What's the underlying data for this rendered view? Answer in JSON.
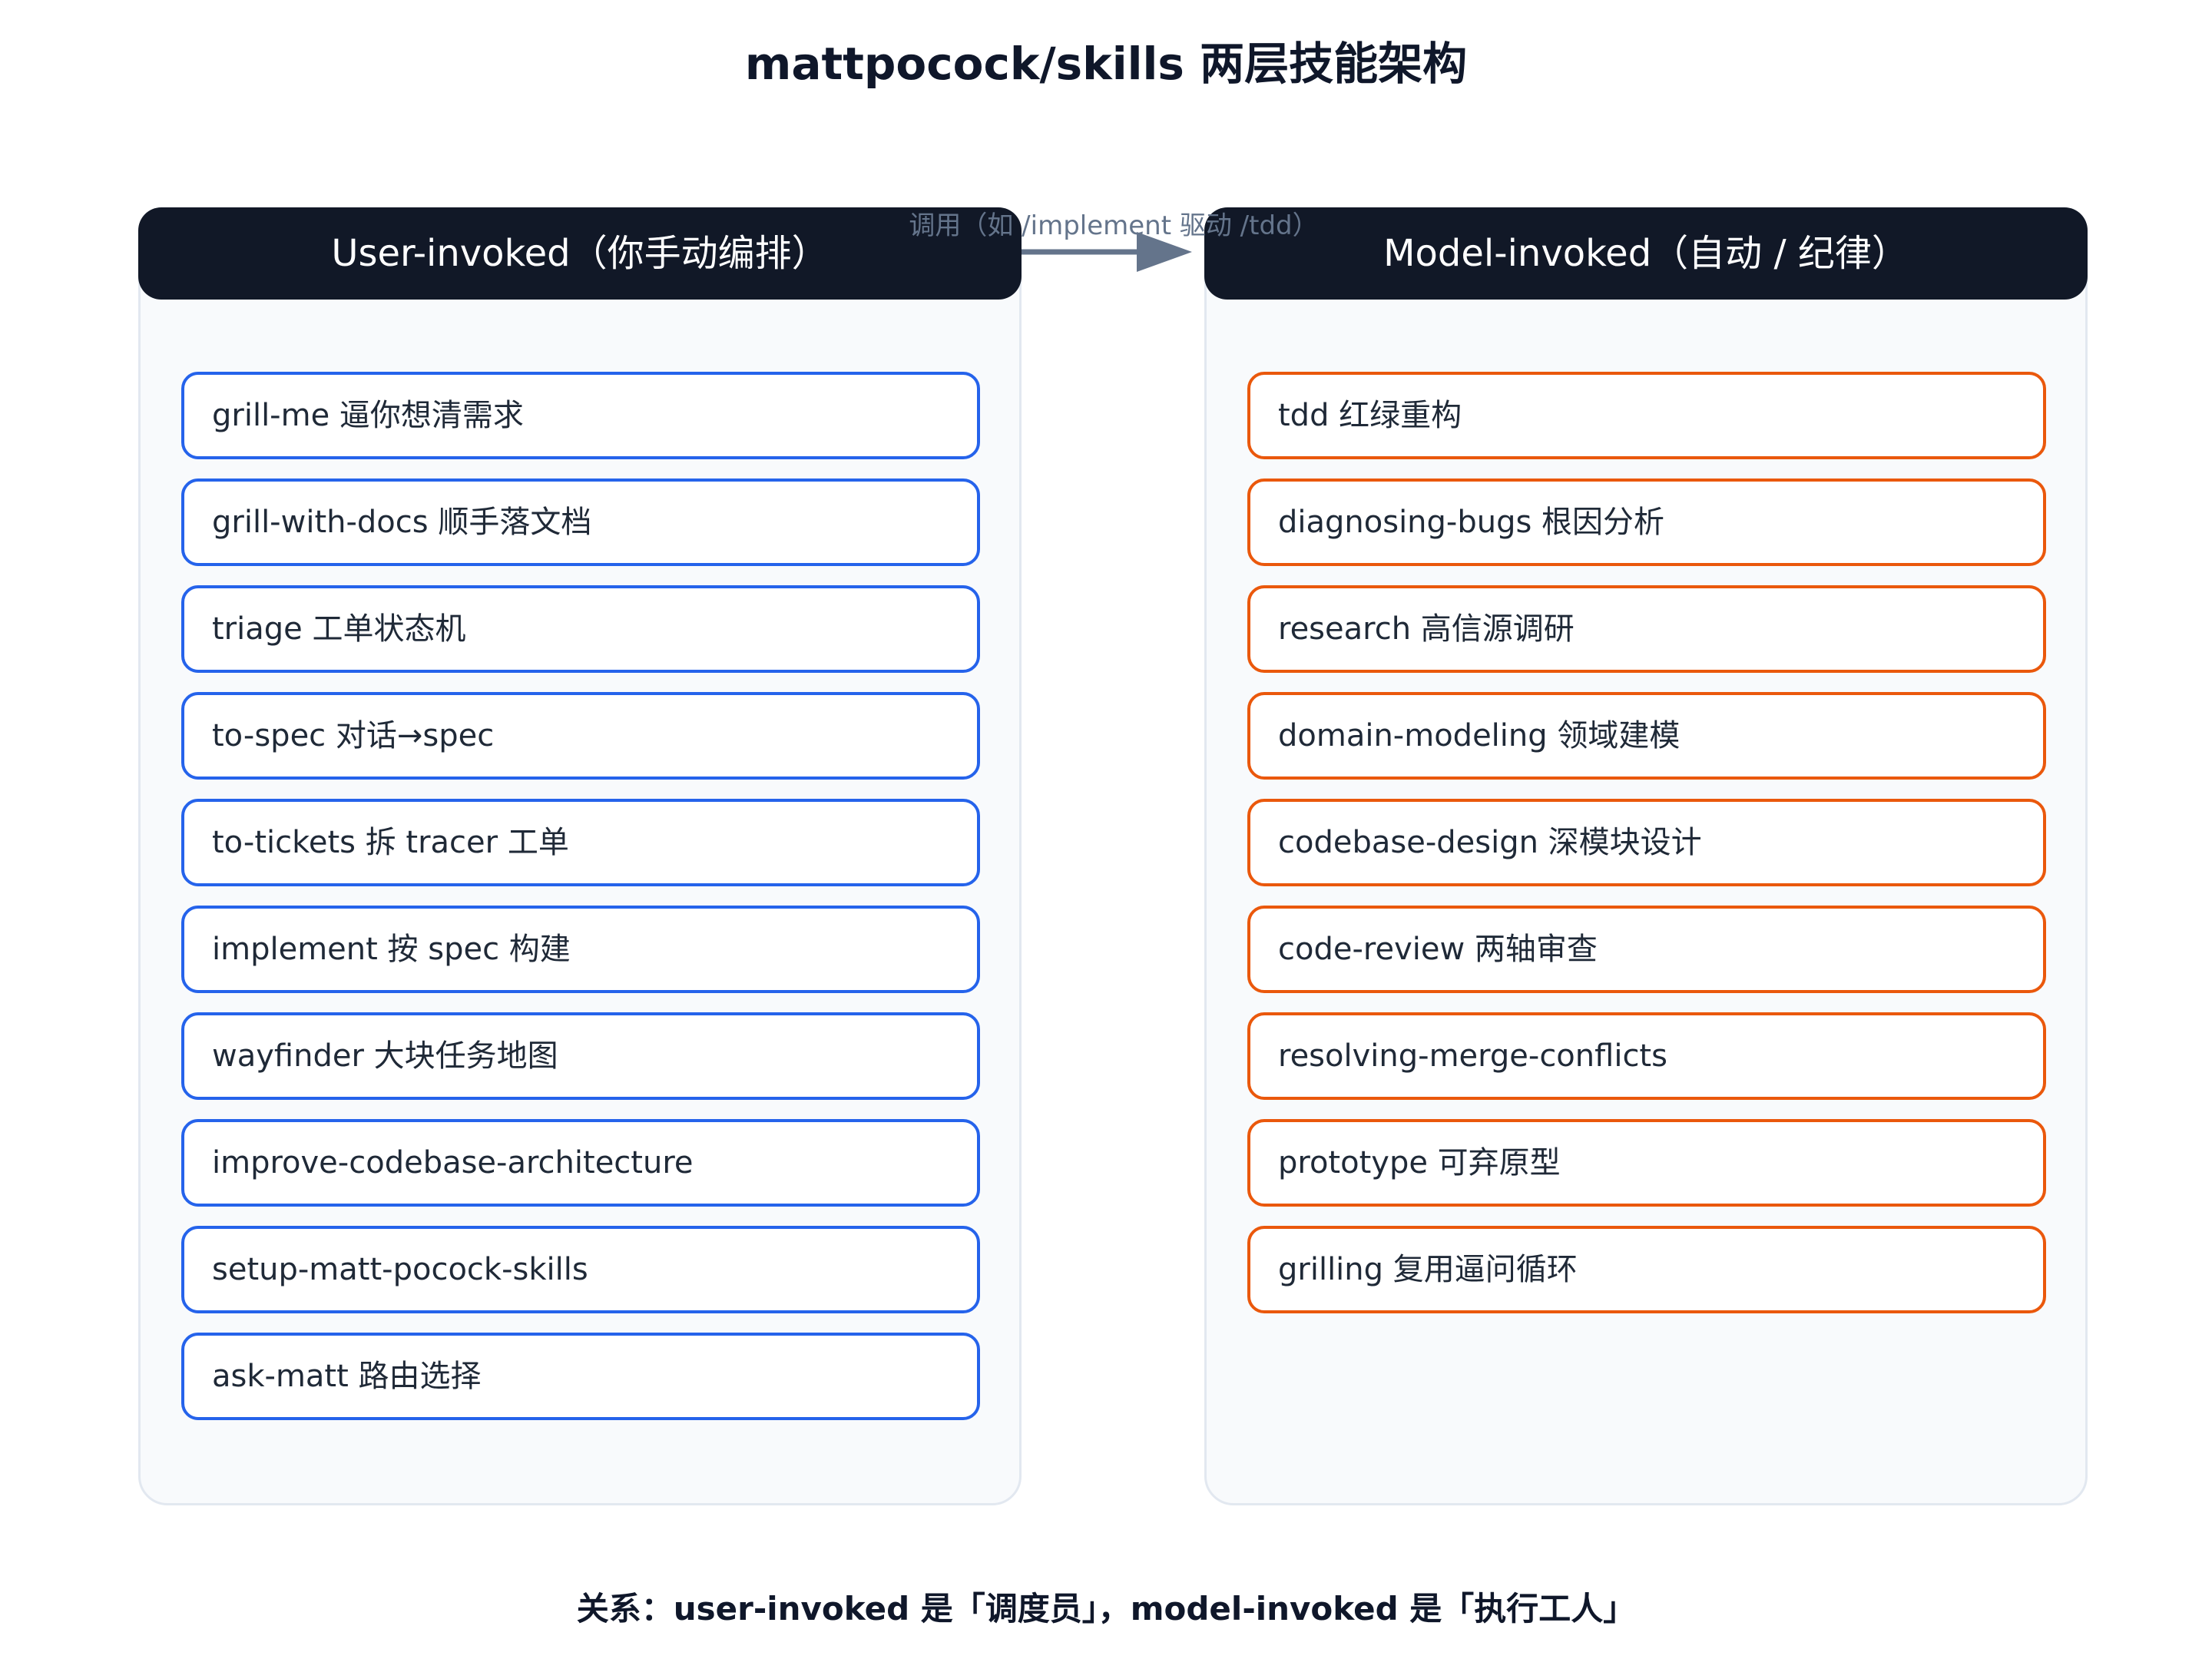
{
  "title": "mattpocock/skills 两层技能架构",
  "user_panel": {
    "header": "User-invoked（你手动编排）",
    "items": [
      "grill-me 逼你想清需求",
      "grill-with-docs 顺手落文档",
      "triage 工单状态机",
      "to-spec 对话→spec",
      "to-tickets 拆 tracer 工单",
      "implement 按 spec 构建",
      "wayfinder 大块任务地图",
      "improve-codebase-architecture",
      "setup-matt-pocock-skills",
      "ask-matt 路由选择"
    ]
  },
  "model_panel": {
    "header": "Model-invoked（自动 / 纪律）",
    "items": [
      "tdd 红绿重构",
      "diagnosing-bugs 根因分析",
      "research 高信源调研",
      "domain-modeling 领域建模",
      "codebase-design 深模块设计",
      "code-review 两轴审查",
      "resolving-merge-conflicts",
      "prototype 可弃原型",
      "grilling 复用逼问循环"
    ]
  },
  "edge": {
    "label": "调用（如 /implement 驱动 /tdd）"
  },
  "footer": "关系：user-invoked 是「调度员」，model-invoked 是「执行工人」",
  "colors": {
    "header_bg": "#111827",
    "user_border": "#2563eb",
    "model_border": "#ea580c",
    "panel_bg": "#f8fafc",
    "arrow": "#64748b"
  }
}
